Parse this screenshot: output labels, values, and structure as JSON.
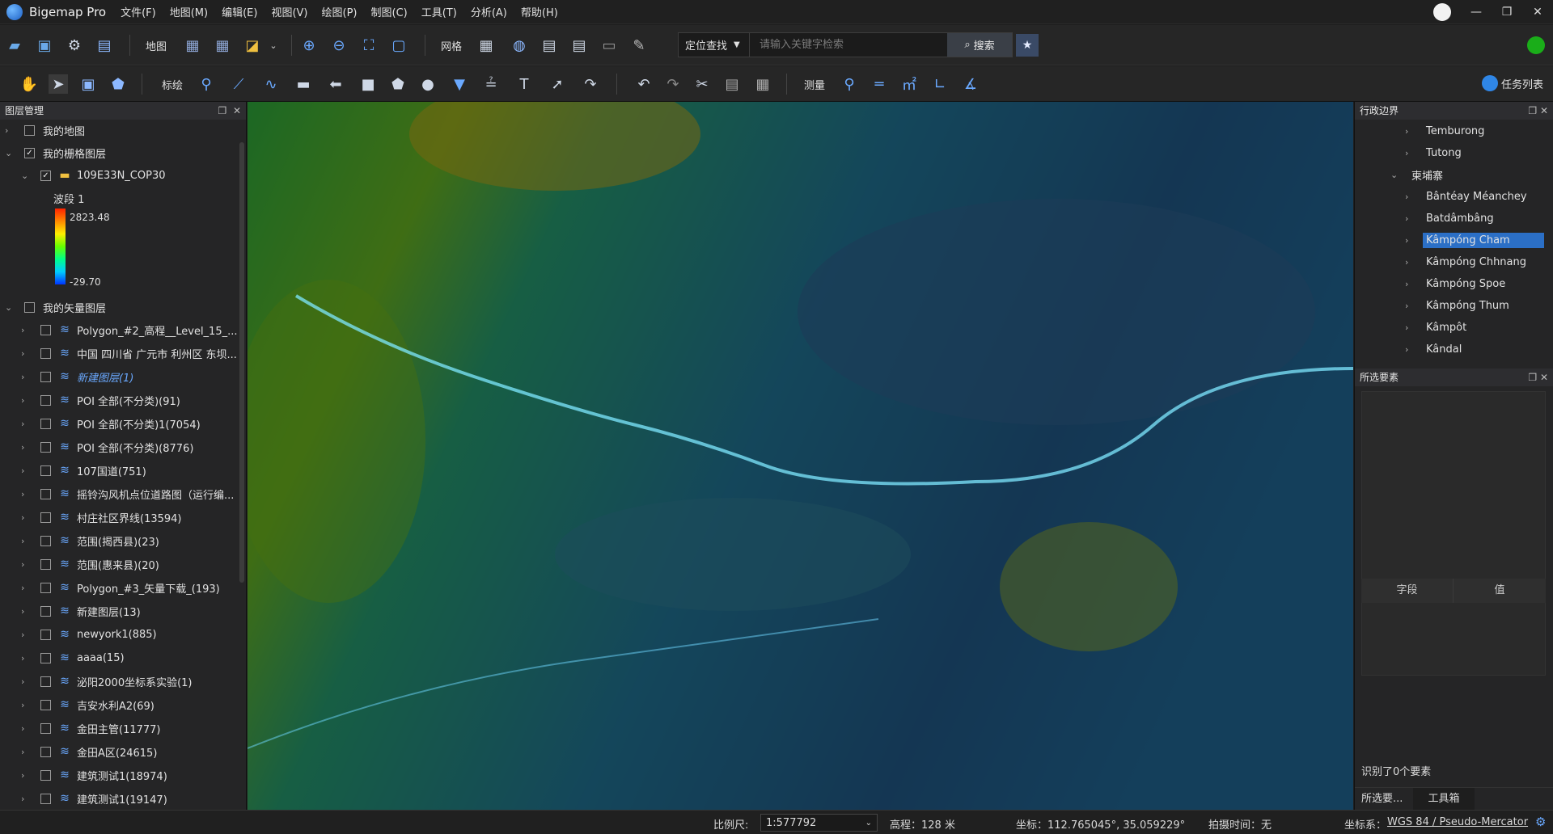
{
  "app": {
    "title": "Bigemap Pro"
  },
  "menu": [
    "文件(F)",
    "地图(M)",
    "编辑(E)",
    "视图(V)",
    "绘图(P)",
    "制图(C)",
    "工具(T)",
    "分析(A)",
    "帮助(H)"
  ],
  "window_controls": {
    "minimize": "—",
    "restore": "❐",
    "close": "✕"
  },
  "toolbar1": {
    "map_label": "地图",
    "grid_label": "网格",
    "locate_select": "定位查找",
    "search_placeholder": "请输入关键字检索",
    "search_button": "搜索"
  },
  "toolbar2": {
    "annotate_label": "标绘",
    "measure_label": "测量",
    "tasklist_label": "任务列表"
  },
  "left_panel": {
    "title": "图层管理",
    "my_map": "我的地图",
    "raster_group": "我的栅格图层",
    "raster_layer": "109E33N_COP30",
    "band_label": "波段 1",
    "legend_max": "2823.48",
    "legend_min": "-29.70",
    "vector_group": "我的矢量图层",
    "vector_layers": [
      "Polygon_#2_高程__Level_15_...",
      "中国 四川省 广元市 利州区 东坝...",
      "新建图层(1)",
      "POI 全部(不分类)(91)",
      "POI 全部(不分类)1(7054)",
      "POI 全部(不分类)(8776)",
      "107国道(751)",
      "摇铃沟风机点位道路图（运行编...",
      "村庄社区界线(13594)",
      "范围(揭西县)(23)",
      "范围(惠来县)(20)",
      "Polygon_#3_矢量下载_(193)",
      "新建图层(13)",
      "newyork1(885)",
      "aaaa(15)",
      "泌阳2000坐标系实验(1)",
      "吉安水利A2(69)",
      "金田主管(11777)",
      "金田A区(24615)",
      "建筑测试1(18974)",
      "建筑测试1(19147)"
    ]
  },
  "right_panel": {
    "admin_title": "行政边界",
    "admin_items": [
      "Temburong",
      "Tutong",
      "柬埔寨",
      "Bântéay Méanchey",
      "Batdâmbâng",
      "Kâmpóng Cham",
      "Kâmpóng Chhnang",
      "Kâmpóng Spoe",
      "Kâmpóng Thum",
      "Kâmpôt",
      "Kândal"
    ],
    "selected_admin": "Kâmpóng Cham",
    "features_title": "所选要素",
    "col_field": "字段",
    "col_value": "值",
    "identified": "识别了0个要素",
    "tab_selected": "所选要...",
    "tab_toolbox": "工具箱"
  },
  "status": {
    "scale_label": "比例尺:",
    "scale_value": "1:577792",
    "elevation": "高程：128 米",
    "coords": "坐标：112.765045°, 35.059229°",
    "capture_time": "拍摄时间：无",
    "crs_label": "坐标系：",
    "crs_value": "WGS 84 / Pseudo-Mercator"
  }
}
